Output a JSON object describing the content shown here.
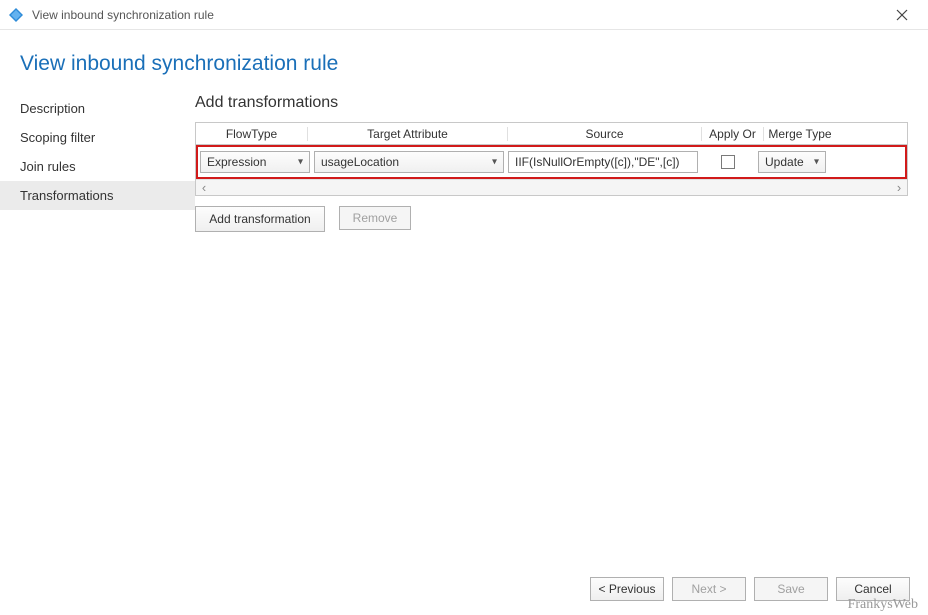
{
  "window": {
    "title": "View inbound synchronization rule"
  },
  "heading": "View inbound synchronization rule",
  "nav": {
    "items": [
      {
        "label": "Description"
      },
      {
        "label": "Scoping filter"
      },
      {
        "label": "Join rules"
      },
      {
        "label": "Transformations",
        "selected": true
      }
    ]
  },
  "section_title": "Add transformations",
  "grid": {
    "headers": {
      "flowtype": "FlowType",
      "target": "Target Attribute",
      "source": "Source",
      "apply": "Apply Or",
      "merge": "Merge Type"
    },
    "row": {
      "flowtype": "Expression",
      "target": "usageLocation",
      "source": "IIF(IsNullOrEmpty([c]),\"DE\",[c])",
      "apply_once": false,
      "merge": "Update"
    }
  },
  "buttons": {
    "add_transformation": "Add transformation",
    "remove": "Remove"
  },
  "footer": {
    "previous": "< Previous",
    "next": "Next >",
    "save": "Save",
    "cancel": "Cancel"
  },
  "watermark": "FrankysWeb"
}
